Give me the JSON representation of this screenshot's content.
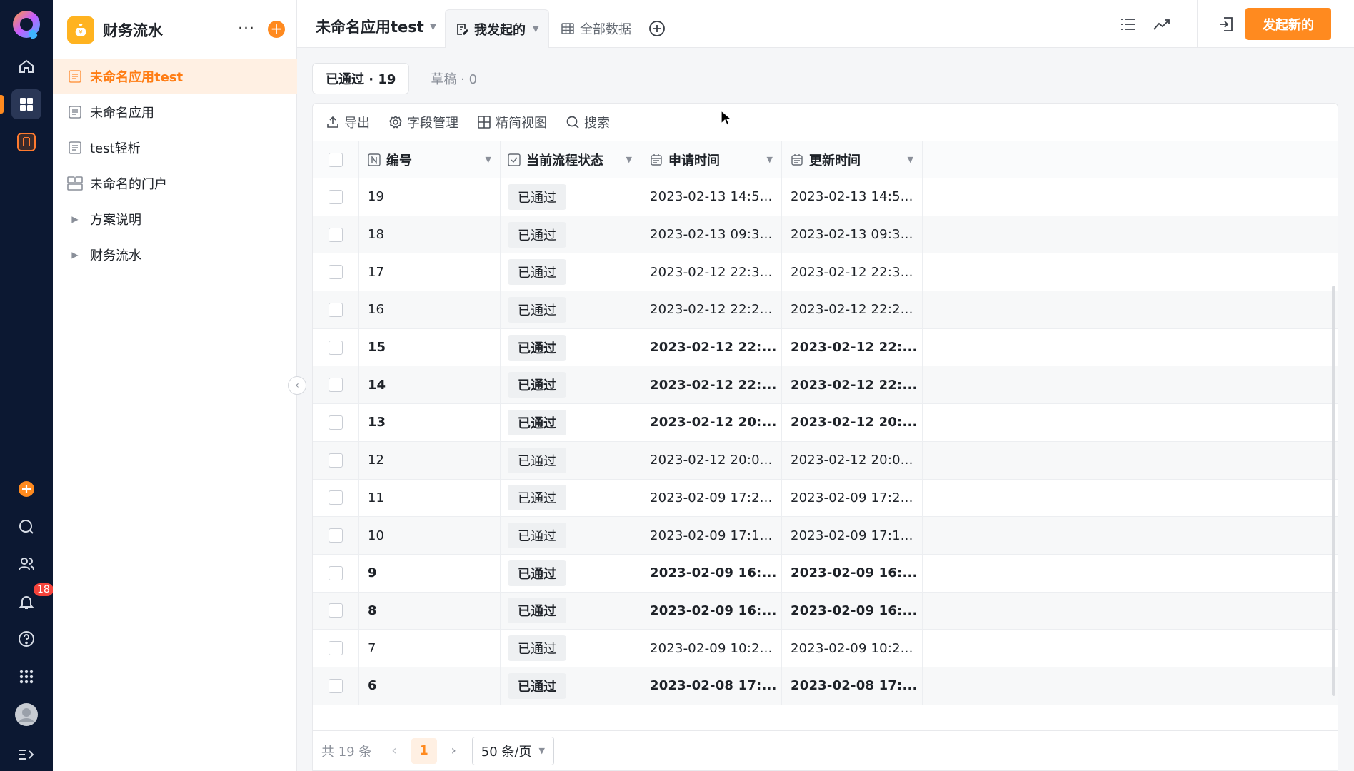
{
  "sidebar": {
    "app_title": "财务流水",
    "items": [
      {
        "label": "未命名应用test",
        "icon": "form-icon",
        "active": true
      },
      {
        "label": "未命名应用",
        "icon": "form-icon"
      },
      {
        "label": "test轻析",
        "icon": "form-icon"
      },
      {
        "label": "未命名的门户",
        "icon": "portal-icon"
      },
      {
        "label": "方案说明",
        "icon": "caret-right-icon"
      },
      {
        "label": "财务流水",
        "icon": "caret-right-icon"
      }
    ]
  },
  "rail": {
    "notification_count": "18"
  },
  "topbar": {
    "app_name": "未命名应用test",
    "tabs": [
      {
        "label": "我发起的",
        "active": true
      },
      {
        "label": "全部数据",
        "active": false
      }
    ],
    "primary_button": "发起新的"
  },
  "status_tabs": [
    {
      "label": "已通过 · 19",
      "active": true
    },
    {
      "label": "草稿 · 0",
      "active": false
    }
  ],
  "toolbar": {
    "export": "导出",
    "fields": "字段管理",
    "compact_view": "精简视图",
    "search": "搜索"
  },
  "table": {
    "columns": [
      "编号",
      "当前流程状态",
      "申请时间",
      "更新时间"
    ],
    "rows": [
      {
        "id": "19",
        "status": "已通过",
        "applied": "2023-02-13 14:5...",
        "updated": "2023-02-13 14:5...",
        "bold": false
      },
      {
        "id": "18",
        "status": "已通过",
        "applied": "2023-02-13 09:3...",
        "updated": "2023-02-13 09:3...",
        "bold": false
      },
      {
        "id": "17",
        "status": "已通过",
        "applied": "2023-02-12 22:3...",
        "updated": "2023-02-12 22:3...",
        "bold": false
      },
      {
        "id": "16",
        "status": "已通过",
        "applied": "2023-02-12 22:2...",
        "updated": "2023-02-12 22:2...",
        "bold": false
      },
      {
        "id": "15",
        "status": "已通过",
        "applied": "2023-02-12 22:...",
        "updated": "2023-02-12 22:...",
        "bold": true
      },
      {
        "id": "14",
        "status": "已通过",
        "applied": "2023-02-12 22:...",
        "updated": "2023-02-12 22:...",
        "bold": true
      },
      {
        "id": "13",
        "status": "已通过",
        "applied": "2023-02-12 20:...",
        "updated": "2023-02-12 20:...",
        "bold": true
      },
      {
        "id": "12",
        "status": "已通过",
        "applied": "2023-02-12 20:0...",
        "updated": "2023-02-12 20:0...",
        "bold": false
      },
      {
        "id": "11",
        "status": "已通过",
        "applied": "2023-02-09 17:2...",
        "updated": "2023-02-09 17:2...",
        "bold": false
      },
      {
        "id": "10",
        "status": "已通过",
        "applied": "2023-02-09 17:1...",
        "updated": "2023-02-09 17:1...",
        "bold": false
      },
      {
        "id": "9",
        "status": "已通过",
        "applied": "2023-02-09 16:...",
        "updated": "2023-02-09 16:...",
        "bold": true
      },
      {
        "id": "8",
        "status": "已通过",
        "applied": "2023-02-09 16:...",
        "updated": "2023-02-09 16:...",
        "bold": true
      },
      {
        "id": "7",
        "status": "已通过",
        "applied": "2023-02-09 10:2...",
        "updated": "2023-02-09 10:2...",
        "bold": false
      },
      {
        "id": "6",
        "status": "已通过",
        "applied": "2023-02-08 17:...",
        "updated": "2023-02-08 17:...",
        "bold": true
      }
    ]
  },
  "footer": {
    "total": "共 19 条",
    "current_page": "1",
    "page_size": "50 条/页"
  },
  "colors": {
    "accent": "#ff8a1f",
    "rail_bg": "#0c1832"
  }
}
